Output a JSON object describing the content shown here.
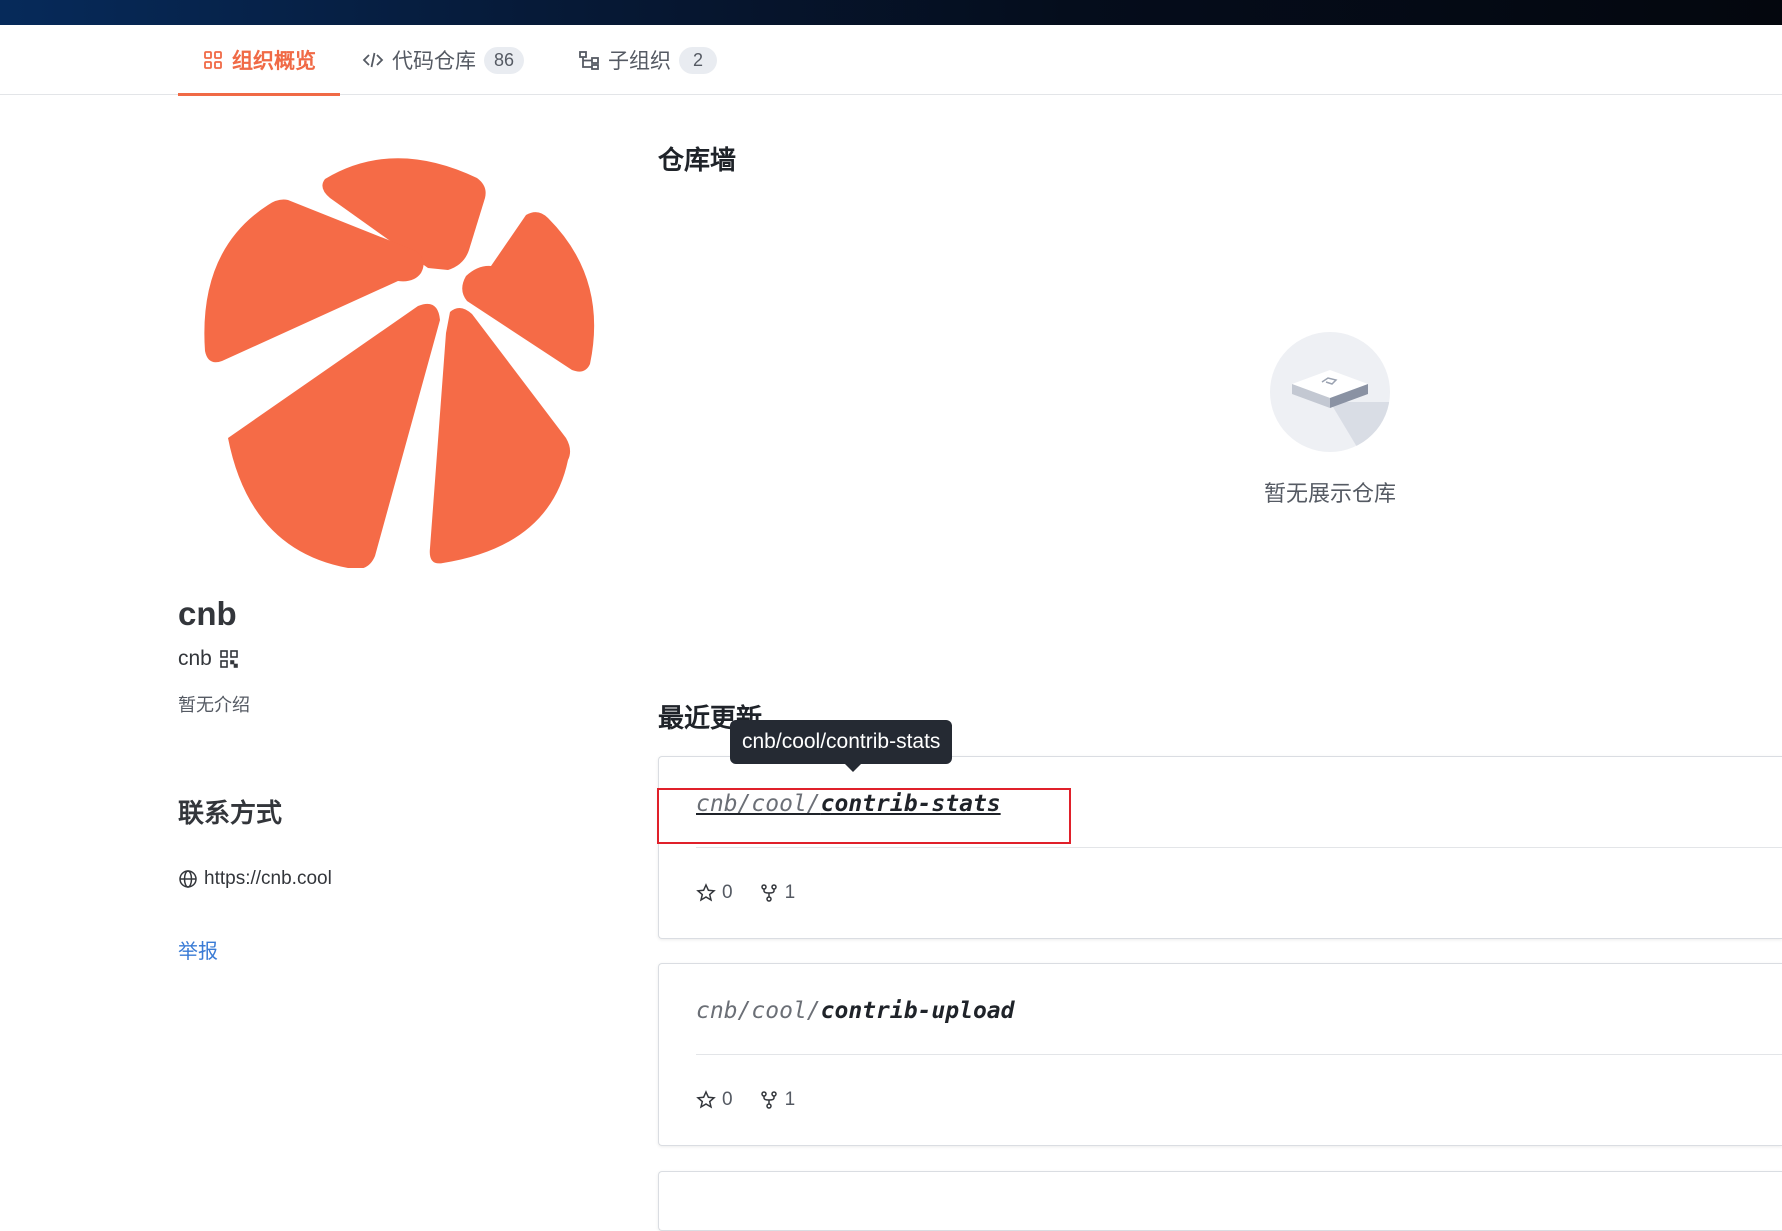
{
  "tabs": [
    {
      "label": "组织概览",
      "icon": "grid-icon",
      "active": true
    },
    {
      "label": "代码仓库",
      "icon": "code-icon",
      "count": "86"
    },
    {
      "label": "子组织",
      "icon": "tree-icon",
      "count": "2"
    }
  ],
  "org": {
    "name": "cnb",
    "slug": "cnb",
    "description": "暂无介绍",
    "logo_color": "#f56b47"
  },
  "contact": {
    "title": "联系方式",
    "website": "https://cnb.cool",
    "report_label": "举报"
  },
  "repo_wall": {
    "title": "仓库墙",
    "empty_text": "暂无展示仓库"
  },
  "recent": {
    "title": "最近更新",
    "repos": [
      {
        "owner": "cnb/cool/",
        "name": "contrib-stats",
        "stars": "0",
        "forks": "1"
      },
      {
        "owner": "cnb/cool/",
        "name": "contrib-upload",
        "stars": "0",
        "forks": "1"
      }
    ]
  },
  "tooltip": {
    "text": "cnb/cool/contrib-stats"
  },
  "colors": {
    "accent": "#f06a46",
    "link": "#3a7bd5",
    "highlight": "#e0202a"
  }
}
